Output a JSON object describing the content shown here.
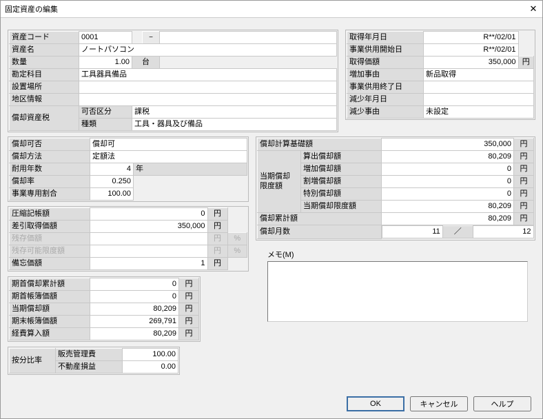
{
  "title": "固定資産の編集",
  "basic": {
    "code_l": "資産コード",
    "code": "0001",
    "name_l": "資産名",
    "name": "ノートパソコン",
    "qty_l": "数量",
    "qty": "1.00",
    "qty_u": "台",
    "acct_l": "勘定科目",
    "acct": "工具器具備品",
    "loc_l": "設置場所",
    "loc": "",
    "region_l": "地区情報",
    "region": "",
    "tax_l": "償却資産税",
    "tax_kahi_l": "可否区分",
    "tax_kahi": "課税",
    "tax_kind_l": "種類",
    "tax_kind": "工具・器具及び備品"
  },
  "acq": {
    "date_l": "取得年月日",
    "date": "R**/02/01",
    "start_l": "事業供用開始日",
    "start": "R**/02/01",
    "price_l": "取得価額",
    "price": "350,000",
    "inc_l": "増加事由",
    "inc": "新品取得",
    "end_l": "事業供用終了日",
    "end": "",
    "dec_date_l": "減少年月日",
    "dec_date": "",
    "dec_l": "減少事由",
    "dec": "未設定"
  },
  "method": {
    "able_l": "償却可否",
    "able": "償却可",
    "way_l": "償却方法",
    "way": "定額法",
    "life_l": "耐用年数",
    "life": "4",
    "life_u": "年",
    "rate_l": "償却率",
    "rate": "0.250",
    "biz_l": "事業専用割合",
    "biz": "100.00"
  },
  "book": {
    "comp_l": "圧縮記帳額",
    "comp": "0",
    "net_l": "差引取得価額",
    "net": "350,000",
    "resid_l": "残存価額",
    "resid": "",
    "limit_l": "残存可能限度額",
    "limit": "",
    "memo_l": "備忘価額",
    "memo": "1"
  },
  "period": {
    "begacc_l": "期首償却累計額",
    "begacc": "0",
    "begbv_l": "期首帳簿価額",
    "begbv": "0",
    "curdep_l": "当期償却額",
    "curdep": "80,209",
    "endbv_l": "期末帳簿価額",
    "endbv": "269,791",
    "exp_l": "経費算入額",
    "exp": "80,209"
  },
  "alloc": {
    "label": "按分比率",
    "r1_l": "販売管理費",
    "r1": "100.00",
    "r2_l": "不動産損益",
    "r2": "0.00"
  },
  "calc": {
    "base_l": "償却計算基礎額",
    "base": "350,000",
    "row_l": "当期償却\n限度額",
    "a_l": "算出償却額",
    "a": "80,209",
    "b_l": "増加償却額",
    "b": "0",
    "c_l": "割増償却額",
    "c": "0",
    "d_l": "特別償却額",
    "d": "0",
    "e_l": "当期償却限度額",
    "e": "80,209",
    "acc_l": "償却累計額",
    "acc": "80,209",
    "mon_l": "償却月数",
    "mon1": "11",
    "mon2": "12"
  },
  "memo_l": "メモ(M)",
  "yen": "円",
  "pct": "%",
  "slash": "／",
  "btn": {
    "ok": "OK",
    "cancel": "キャンセル",
    "help": "ヘルプ"
  }
}
